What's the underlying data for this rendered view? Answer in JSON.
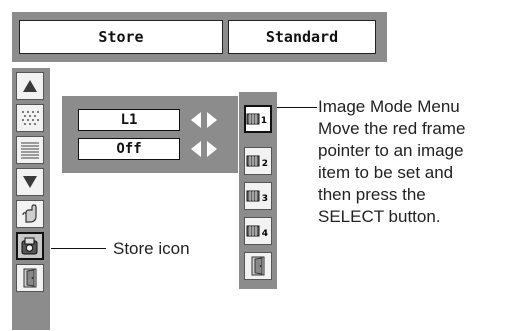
{
  "top_bar": {
    "store_label": "Store",
    "standard_label": "Standard"
  },
  "left_column": {
    "icons": [
      {
        "name": "up-arrow-icon"
      },
      {
        "name": "dot-pattern-icon"
      },
      {
        "name": "lines-pattern-icon"
      },
      {
        "name": "down-arrow-icon"
      },
      {
        "name": "hand-pointer-icon"
      },
      {
        "name": "store-icon",
        "selected": true
      },
      {
        "name": "exit-door-icon"
      }
    ]
  },
  "adjustment_panel": {
    "level_value": "L1",
    "state_value": "Off"
  },
  "right_column": {
    "items": [
      {
        "name": "image-mode-1-icon",
        "number": "1",
        "selected": true
      },
      {
        "name": "image-mode-2-icon",
        "number": "2"
      },
      {
        "name": "image-mode-3-icon",
        "number": "3"
      },
      {
        "name": "image-mode-4-icon",
        "number": "4"
      },
      {
        "name": "exit-door-icon"
      }
    ]
  },
  "callouts": {
    "store_icon": "Store icon",
    "image_mode_lines": [
      "Image Mode Menu",
      "Move the red frame",
      "pointer to an image",
      "item to be set and",
      "then press the",
      "SELECT button."
    ]
  },
  "colors": {
    "panel_gray": "#8c8c8c",
    "field_white": "#ffffff",
    "text_dark": "#111111"
  }
}
